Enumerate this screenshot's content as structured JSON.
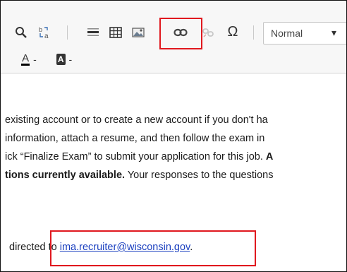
{
  "toolbar": {
    "row1": {
      "format_select": {
        "value": "Normal"
      },
      "buttons": [
        {
          "name": "find-icon"
        },
        {
          "name": "replace-icon"
        },
        {
          "name": "horizontal-line-icon"
        },
        {
          "name": "table-icon"
        },
        {
          "name": "image-icon"
        },
        {
          "name": "link-icon"
        },
        {
          "name": "unlink-icon"
        },
        {
          "name": "special-character-icon",
          "glyph": "Ω"
        }
      ]
    },
    "row2": {
      "text_color_label": "A",
      "bg_color_label": "A",
      "dropdown_glyph": "-"
    }
  },
  "content": {
    "lines": [
      "existing account or to create a new account if you don't ha",
      "information, attach a resume, and then follow the exam in",
      "ick “Finalize Exam” to submit your application for this job. ",
      "tions currently available.",
      "directed to"
    ],
    "line3_tail_bold": "A",
    "line4_rest": " Your responses to the questions",
    "email": "ima.recruiter@wisconsin.gov",
    "after_email": "."
  },
  "colors": {
    "highlight": "#e0181e",
    "link": "#1a3fbf",
    "toolbar_bg": "#f7f7f7"
  }
}
